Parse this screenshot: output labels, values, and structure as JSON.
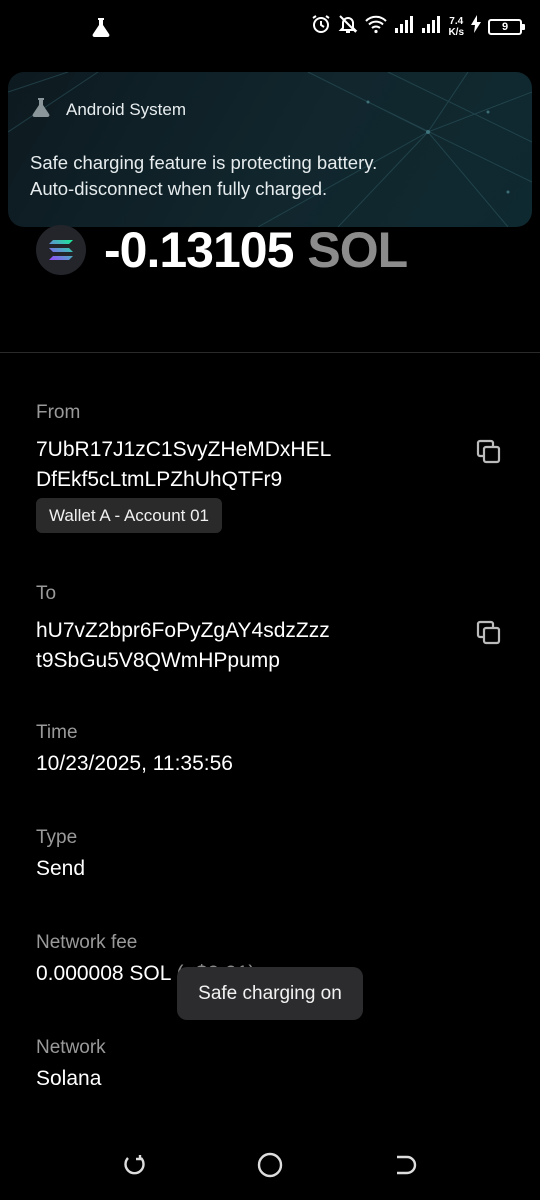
{
  "status_bar": {
    "speed_value": "7.4",
    "speed_unit": "K/s",
    "battery_level": "9",
    "icons": [
      "flask-icon",
      "alarm-icon",
      "bell-off-icon",
      "wifi-icon",
      "signal-icon",
      "signal-icon",
      "charging-icon",
      "battery-icon"
    ]
  },
  "notification": {
    "app_name": "Android System",
    "line1": "Safe charging feature is protecting battery.",
    "line2": "Auto-disconnect when fully charged."
  },
  "transaction": {
    "amount": "-0.13105",
    "unit": "SOL",
    "from_label": "From",
    "from_line1": "7UbR17J1zC1SvyZHeMDxHEL",
    "from_line2": "DfEkf5cLtmLPZhUhQTFr9",
    "wallet_tag": "Wallet A - Account 01",
    "to_label": "To",
    "to_line1": "hU7vZ2bpr6FoPyZgAY4sdzZzz",
    "to_line2": "t9SbGu5V8QWmHPpump",
    "time_label": "Time",
    "time_value": "10/23/2025, 11:35:56",
    "type_label": "Type",
    "type_value": "Send",
    "fee_label": "Network fee",
    "fee_value": "0.000008 SOL",
    "fee_usd": "(<$0.01)",
    "network_label": "Network",
    "network_value": "Solana"
  },
  "toast": {
    "text": "Safe charging on"
  },
  "colors": {
    "background": "#000000",
    "label_gray": "#9a9a9a",
    "notification_bg": "#11262d",
    "tag_bg": "#2a2a2a",
    "toast_bg": "#2c2c2e"
  }
}
